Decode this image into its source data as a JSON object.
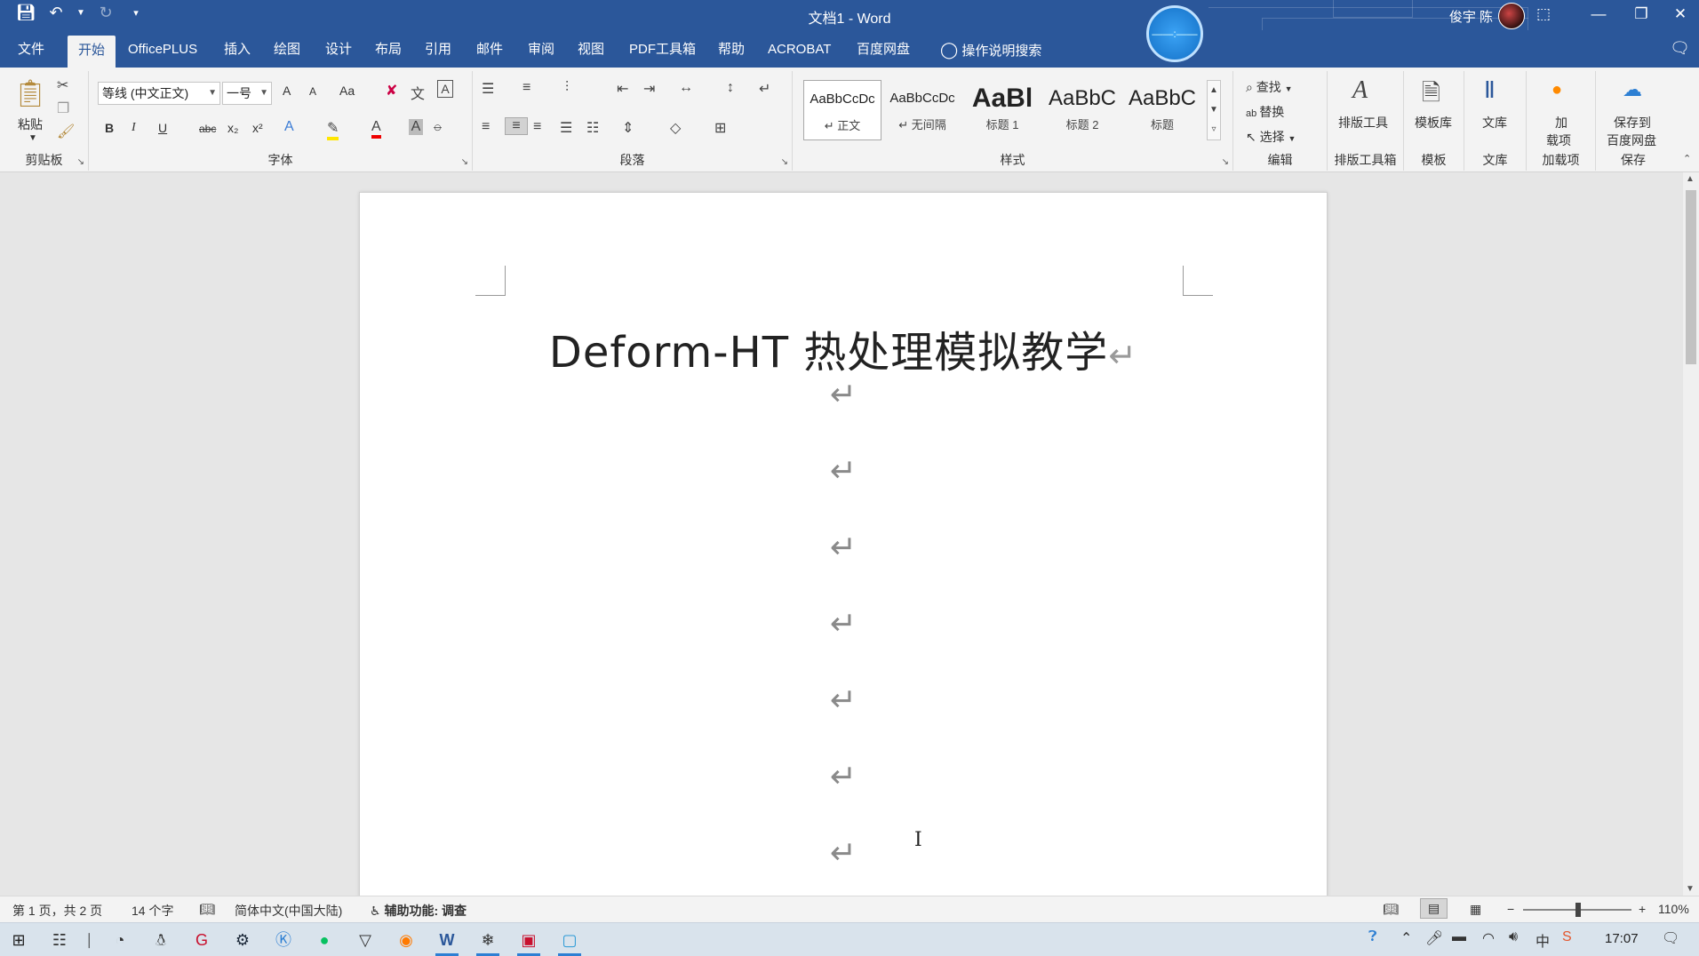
{
  "titlebar": {
    "doc_title": "文档1  -  Word",
    "user": "俊宇 陈",
    "widget_text": "——:——",
    "qat": {
      "save_icon": "save-icon",
      "undo_icon": "undo-icon",
      "redo_icon": "redo-icon",
      "customize_icon": "customize-qat-icon"
    },
    "controls": {
      "ribbon_display": "ribbon-display-icon",
      "minimize": "minimize-icon",
      "restore": "restore-icon",
      "close": "close-icon"
    }
  },
  "menu": {
    "tabs": [
      "文件",
      "开始",
      "OfficePLUS",
      "插入",
      "绘图",
      "设计",
      "布局",
      "引用",
      "邮件",
      "审阅",
      "视图",
      "PDF工具箱",
      "帮助",
      "ACROBAT",
      "百度网盘"
    ],
    "active_tab": "开始",
    "tell_me": "操作说明搜索"
  },
  "ribbon": {
    "clipboard": {
      "paste": "粘贴",
      "label": "剪贴板"
    },
    "font": {
      "name": "等线 (中文正文)",
      "size": "一号",
      "label": "字体",
      "grow": "A",
      "shrink": "A",
      "case": "Aa",
      "bold": "B",
      "italic": "I",
      "underline": "U",
      "strike": "abc",
      "sub": "x₂",
      "sup": "x²"
    },
    "paragraph": {
      "label": "段落"
    },
    "styles": {
      "items": [
        {
          "preview": "AaBbCcDc",
          "name": "↵ 正文"
        },
        {
          "preview": "AaBbCcDc",
          "name": "↵ 无间隔"
        },
        {
          "preview": "AaBl",
          "name": "标题 1"
        },
        {
          "preview": "AaBbC",
          "name": "标题 2"
        },
        {
          "preview": "AaBbC",
          "name": "标题"
        }
      ],
      "label": "样式"
    },
    "editing": {
      "find": "查找",
      "replace": "替换",
      "select": "选择",
      "label": "编辑"
    },
    "layout_tool": {
      "button": "排版工具",
      "label": "排版工具箱"
    },
    "template": {
      "button": "模板库",
      "label": "模板"
    },
    "library": {
      "button": "文库",
      "label": "文库"
    },
    "addins": {
      "button_line1": "加",
      "button_line2": "载项",
      "label": "加载项"
    },
    "save": {
      "button_line1": "保存到",
      "button_line2": "百度网盘",
      "label": "保存"
    }
  },
  "document": {
    "heading": "Deform-HT 热处理模拟教学",
    "paragraph_mark": "↵",
    "empty_paragraphs": 7
  },
  "status": {
    "page": "第 1 页，共 2 页",
    "words": "14 个字",
    "language": "简体中文(中国大陆)",
    "accessibility": "辅助功能: 调查",
    "zoom": "110%",
    "zoom_minus": "−",
    "zoom_plus": "+"
  },
  "taskbar": {
    "time": "17:07",
    "ime": "中",
    "apps": [
      "start-icon",
      "task-view-icon",
      "clock-app-icon",
      "qq-icon",
      "g-app-icon",
      "steam-icon",
      "k-app-icon",
      "wechat-icon",
      "vpn-icon",
      "firefox-icon",
      "word-icon",
      "deform-icon",
      "screen-recorder-icon",
      "window-icon"
    ]
  },
  "colors": {
    "brand": "#2b579a",
    "ribbon_bg": "#f3f3f3",
    "canvas_bg": "#e6e6e6",
    "page_bg": "#ffffff"
  }
}
